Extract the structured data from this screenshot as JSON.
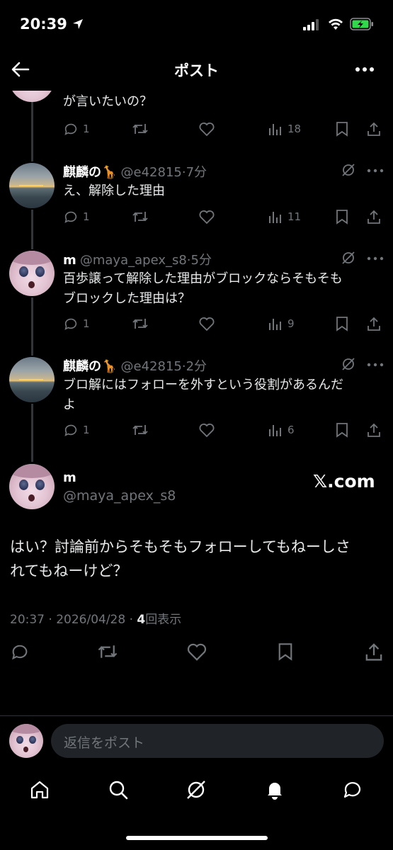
{
  "status_bar": {
    "time": "20:39"
  },
  "header": {
    "title": "ポスト"
  },
  "partial_reply": {
    "text": "が言いたいの？",
    "replies": "1",
    "views": "18"
  },
  "replies": [
    {
      "name": "麒麟の🦒",
      "meta": "@e42815·7分",
      "text_lines": [
        "え、解除した理由"
      ],
      "replies": "1",
      "views": "11"
    },
    {
      "name": "m",
      "meta": "@maya_apex_s8·5分",
      "text_lines": [
        "百歩譲って解除した理由がブロックならそもそも",
        "ブロックした理由は？"
      ],
      "replies": "1",
      "views": "9"
    },
    {
      "name": "麒麟の🦒",
      "meta": "@e42815·2分",
      "text_lines": [
        "ブロ解にはフォローを外すという役割があるんだ",
        "よ"
      ],
      "replies": "1",
      "views": "6"
    }
  ],
  "main_post": {
    "name": "m",
    "handle": "@maya_apex_s8",
    "watermark": "𝕏.com",
    "text_lines": [
      "はい？討論前からそもそもフォローしてもねーしさ",
      "れてもねーけど？"
    ],
    "timestamp": "20:37 · 2026/04/28 · ",
    "views_count": "4",
    "views_label": "回表示"
  },
  "reply_composer": {
    "placeholder": "返信をポスト"
  },
  "bottom_nav": [
    "home-icon",
    "search-icon",
    "grok-icon",
    "notifications-icon",
    "messages-icon"
  ]
}
